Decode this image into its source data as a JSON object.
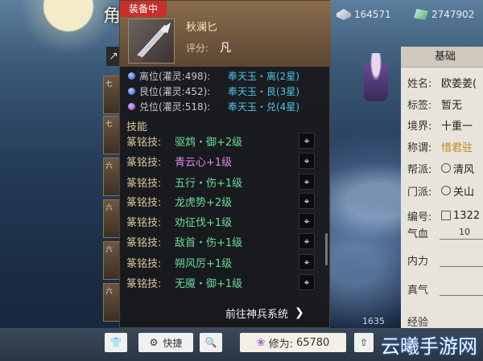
{
  "window": {
    "title_char": "角"
  },
  "currency": [
    {
      "icon": "silver-ingot-icon",
      "value": "164571"
    },
    {
      "icon": "jade-icon",
      "value": "2747902"
    }
  ],
  "tooltip": {
    "badge": "装备中",
    "item_name": "秋澜匕",
    "score_label": "评分:",
    "score_value": "凡",
    "gems": [
      {
        "color": "blue",
        "slot": "离位(灌灵:498):",
        "name": "奉天玉・离(2星)"
      },
      {
        "color": "blue",
        "slot": "艮位(灌灵:452):",
        "name": "奉天玉・艮(3星)"
      },
      {
        "color": "purple",
        "slot": "兑位(灌灵:518):",
        "name": "奉天玉・兑(4星)"
      }
    ],
    "skills_heading": "技能",
    "skills": [
      {
        "prefix": "篆铭技:",
        "name": "驱鸩・御+2级",
        "color": "green"
      },
      {
        "prefix": "篆铭技:",
        "name": "青云心+1级",
        "color": "purple"
      },
      {
        "prefix": "篆铭技:",
        "name": "五行・伤+1级",
        "color": "green"
      },
      {
        "prefix": "篆铭技:",
        "name": "龙虎势+2级",
        "color": "green"
      },
      {
        "prefix": "篆铭技:",
        "name": "劝征伐+1级",
        "color": "green"
      },
      {
        "prefix": "篆铭技:",
        "name": "敌首・伤+1级",
        "color": "green"
      },
      {
        "prefix": "篆铭技:",
        "name": "朔风厉+1级",
        "color": "green"
      },
      {
        "prefix": "篆铭技:",
        "name": "无魇・御+1级",
        "color": "green"
      }
    ],
    "goto_label": "前往神兵系统"
  },
  "info_panel": {
    "tab": "基础",
    "rows": [
      {
        "label": "姓名:",
        "value": "欧姜姜(",
        "style": ""
      },
      {
        "label": "标签:",
        "value": "暂无",
        "style": ""
      },
      {
        "label": "境界:",
        "value": "十重一",
        "style": ""
      },
      {
        "label": "称谓:",
        "value": "惜君驻",
        "style": "gold"
      },
      {
        "label": "帮派:",
        "value": "清风",
        "style": "",
        "icon": "guild-icon"
      },
      {
        "label": "门派:",
        "value": "关山",
        "style": "",
        "icon": "sect-icon"
      },
      {
        "label": "编号:",
        "value": "1322",
        "style": "",
        "icon": "id-icon"
      }
    ],
    "stats": [
      {
        "label": "气血",
        "num": "10"
      },
      {
        "label": "内力",
        "num": ""
      },
      {
        "label": "真气",
        "num": ""
      },
      {
        "label": "经验",
        "num": ""
      }
    ]
  },
  "power_value": "1635",
  "bottom_bar": {
    "quick_label": "快捷",
    "xiuwei_label": "修为:",
    "xiuwei_value": "65780"
  },
  "slots": [
    "七",
    "七",
    "六",
    "六",
    "六",
    "六",
    "六"
  ],
  "watermark": "云曦手游网"
}
